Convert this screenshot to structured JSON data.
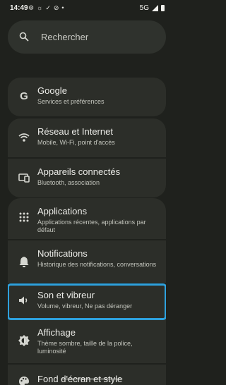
{
  "status_bar": {
    "time": "14:49",
    "left_icons": [
      "gear-icon",
      "brightness-icon",
      "check-icon",
      "shield-off-icon",
      "dot-icon"
    ],
    "network": "5G"
  },
  "search": {
    "placeholder": "Rechercher"
  },
  "groups": [
    {
      "items": [
        {
          "icon": "google-icon",
          "title": "Google",
          "subtitle": "Services et préférences"
        }
      ]
    },
    {
      "items": [
        {
          "icon": "wifi-icon",
          "title": "Réseau et Internet",
          "subtitle": "Mobile, Wi-Fi, point d'accès"
        },
        {
          "icon": "devices-icon",
          "title": "Appareils connectés",
          "subtitle": "Bluetooth, association"
        }
      ]
    },
    {
      "items": [
        {
          "icon": "apps-grid-icon",
          "title": "Applications",
          "subtitle": "Applications récentes, applications par défaut"
        },
        {
          "icon": "bell-icon",
          "title": "Notifications",
          "subtitle": "Historique des notifications, conversations"
        },
        {
          "icon": "speaker-icon",
          "title": "Son et vibreur",
          "subtitle": "Volume, vibreur, Ne pas déranger",
          "selected": true
        },
        {
          "icon": "brightness-icon",
          "title": "Affichage",
          "subtitle": "Thème sombre, taille de la police, luminosité"
        },
        {
          "icon": "palette-icon",
          "title_prefix": "Fond ",
          "title_strike": "d'écran et style",
          "subtitle": ""
        }
      ]
    }
  ],
  "colors": {
    "accent_selection": "#2ea1dd",
    "background": "#1f211d",
    "card": "#2c2e29"
  }
}
